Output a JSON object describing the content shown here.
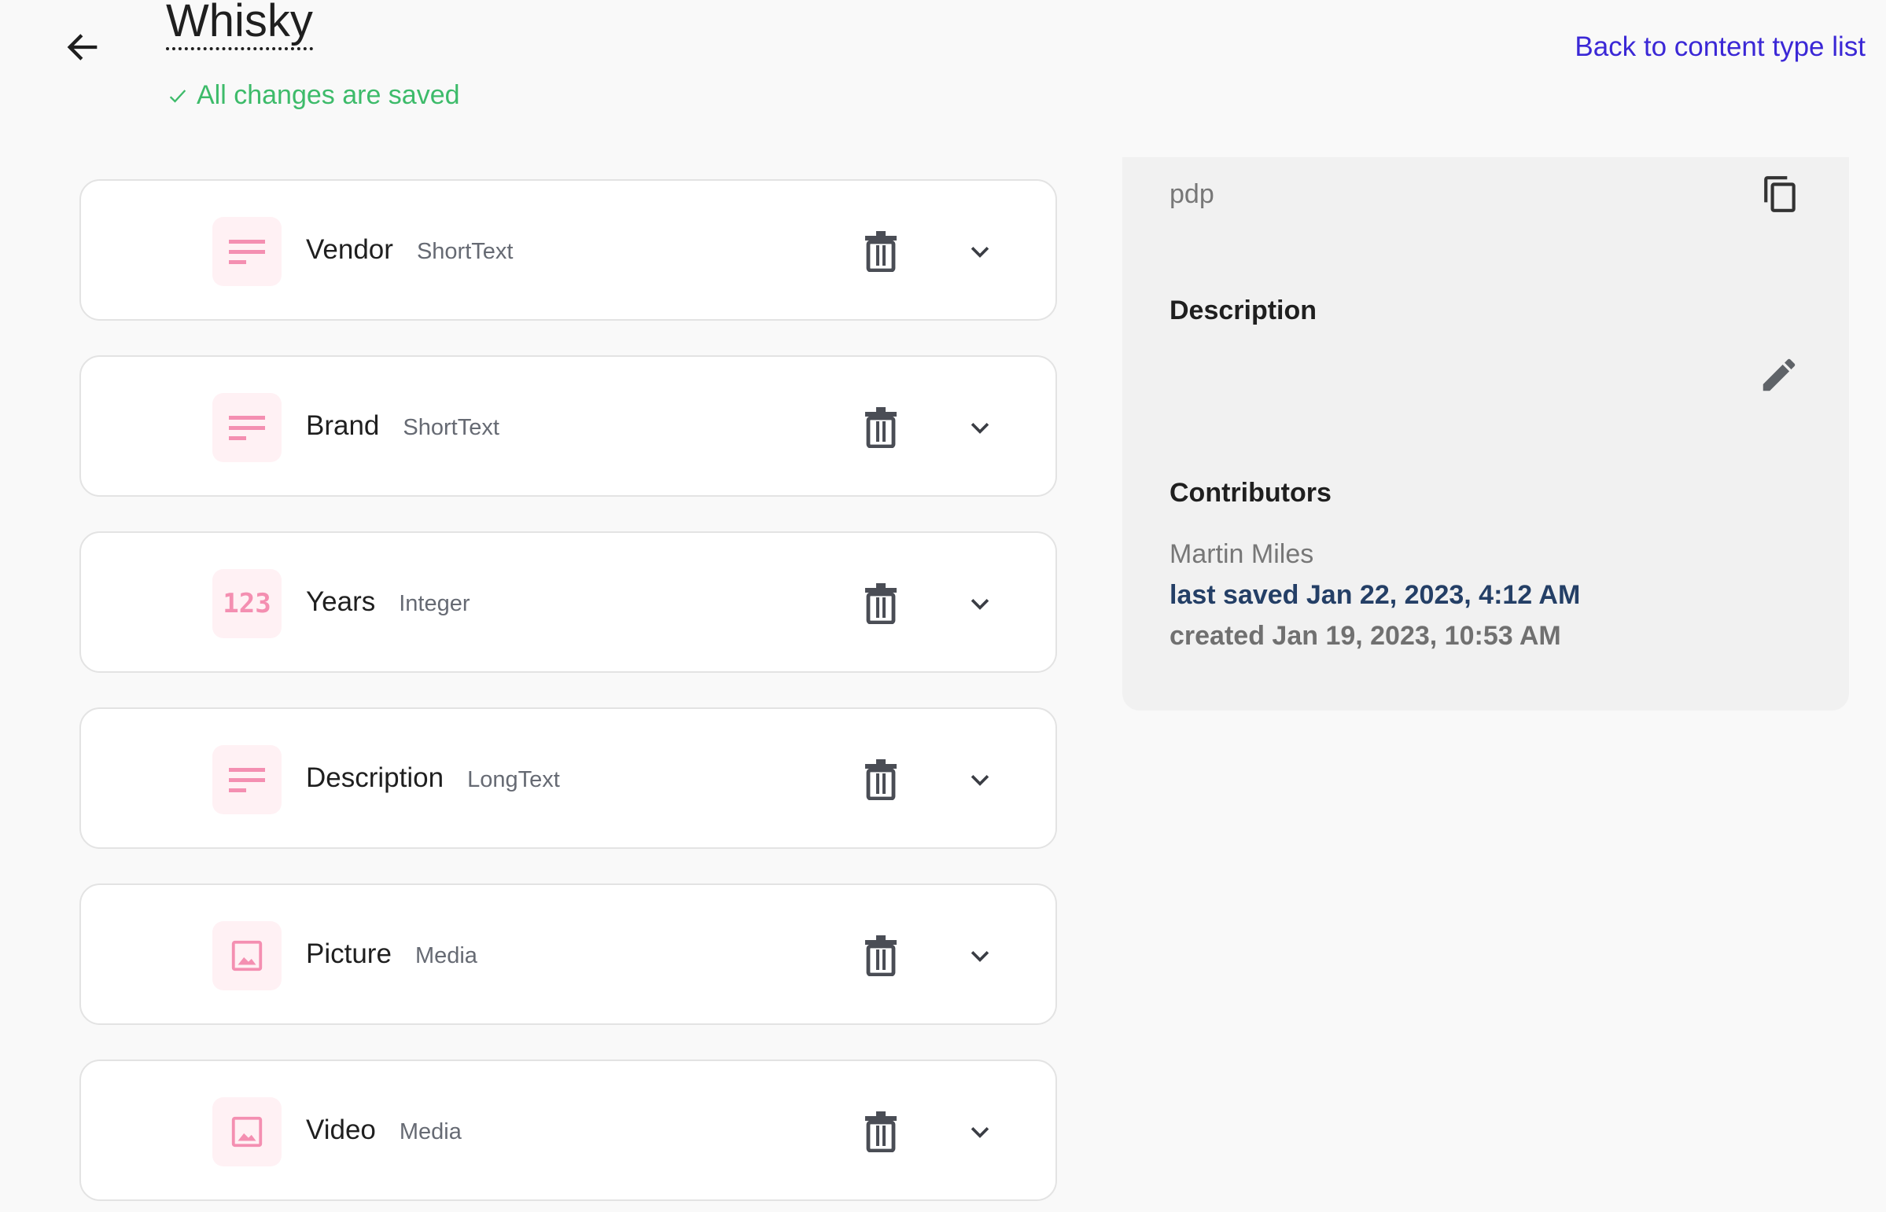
{
  "header": {
    "title": "Whisky",
    "status": "All changes are saved",
    "back_link": "Back to content type list"
  },
  "fields": [
    {
      "name": "Vendor",
      "type": "ShortText",
      "icon": "text-lines-icon"
    },
    {
      "name": "Brand",
      "type": "ShortText",
      "icon": "text-lines-icon"
    },
    {
      "name": "Years",
      "type": "Integer",
      "icon": "number-123-icon"
    },
    {
      "name": "Description",
      "type": "LongText",
      "icon": "text-lines-icon"
    },
    {
      "name": "Picture",
      "type": "Media",
      "icon": "image-icon"
    },
    {
      "name": "Video",
      "type": "Media",
      "icon": "image-icon"
    }
  ],
  "panel": {
    "api_id": "pdp",
    "description_heading": "Description",
    "contributors_heading": "Contributors",
    "contributor": "Martin Miles",
    "last_saved": "last saved Jan 22, 2023, 4:12 AM",
    "created": "created Jan 19, 2023, 10:53 AM"
  },
  "colors": {
    "accent": "#3b28d6",
    "success": "#3dbb6a",
    "icon_pink": "#f48fb1",
    "last_saved": "#243f66"
  }
}
